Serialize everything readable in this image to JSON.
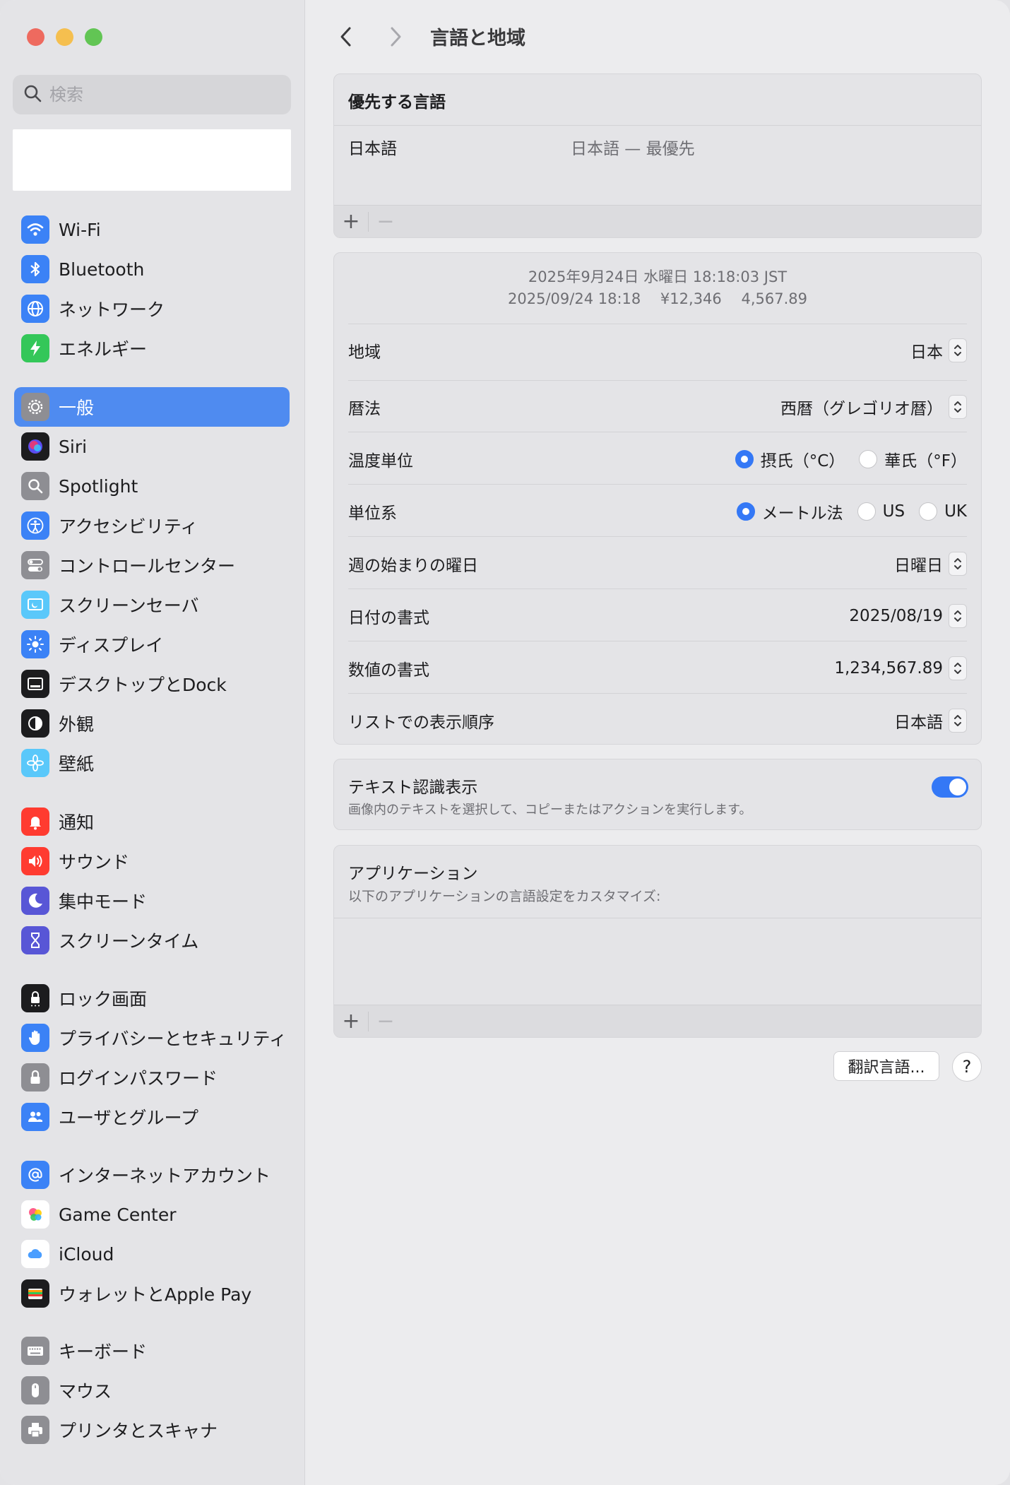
{
  "search": {
    "placeholder": "検索"
  },
  "sidebar": {
    "items": [
      {
        "label": "Wi-Fi",
        "icon": "wifi-icon",
        "color": "#3b82f6"
      },
      {
        "label": "Bluetooth",
        "icon": "bluetooth-icon",
        "color": "#3b82f6"
      },
      {
        "label": "ネットワーク",
        "icon": "globe-icon",
        "color": "#3b82f6"
      },
      {
        "label": "エネルギー",
        "icon": "bolt-icon",
        "color": "#34c759"
      },
      {
        "label": "一般",
        "icon": "gear-icon",
        "color": "#8e8e93",
        "selected": true
      },
      {
        "label": "Siri",
        "icon": "siri-icon",
        "color": "#1c1c1e"
      },
      {
        "label": "Spotlight",
        "icon": "magnifier-icon",
        "color": "#8e8e93"
      },
      {
        "label": "アクセシビリティ",
        "icon": "accessibility-icon",
        "color": "#3b82f6"
      },
      {
        "label": "コントロールセンター",
        "icon": "toggles-icon",
        "color": "#8e8e93"
      },
      {
        "label": "スクリーンセーバ",
        "icon": "screensaver-icon",
        "color": "#5ac8fa"
      },
      {
        "label": "ディスプレイ",
        "icon": "sun-icon",
        "color": "#3b82f6"
      },
      {
        "label": "デスクトップとDock",
        "icon": "dock-icon",
        "color": "#1c1c1e"
      },
      {
        "label": "外観",
        "icon": "appearance-icon",
        "color": "#1c1c1e"
      },
      {
        "label": "壁紙",
        "icon": "flower-icon",
        "color": "#5ac8fa"
      },
      {
        "label": "通知",
        "icon": "bell-icon",
        "color": "#ff3b30"
      },
      {
        "label": "サウンド",
        "icon": "speaker-icon",
        "color": "#ff3b30"
      },
      {
        "label": "集中モード",
        "icon": "moon-icon",
        "color": "#5856d6"
      },
      {
        "label": "スクリーンタイム",
        "icon": "hourglass-icon",
        "color": "#5856d6"
      },
      {
        "label": "ロック画面",
        "icon": "lock-screen-icon",
        "color": "#1c1c1e"
      },
      {
        "label": "プライバシーとセキュリティ",
        "icon": "hand-icon",
        "color": "#3b82f6"
      },
      {
        "label": "ログインパスワード",
        "icon": "lock-icon",
        "color": "#8e8e93"
      },
      {
        "label": "ユーザとグループ",
        "icon": "users-icon",
        "color": "#3b82f6"
      },
      {
        "label": "インターネットアカウント",
        "icon": "at-icon",
        "color": "#3b82f6"
      },
      {
        "label": "Game Center",
        "icon": "game-center-icon",
        "color": "#ffffff"
      },
      {
        "label": "iCloud",
        "icon": "cloud-icon",
        "color": "#ffffff"
      },
      {
        "label": "ウォレットとApple Pay",
        "icon": "wallet-icon",
        "color": "#1c1c1e"
      },
      {
        "label": "キーボード",
        "icon": "keyboard-icon",
        "color": "#8e8e93"
      },
      {
        "label": "マウス",
        "icon": "mouse-icon",
        "color": "#8e8e93"
      },
      {
        "label": "プリンタとスキャナ",
        "icon": "printer-icon",
        "color": "#8e8e93"
      }
    ]
  },
  "toolbar": {
    "title": "言語と地域"
  },
  "preferred": {
    "title": "優先する言語",
    "language": "日本語",
    "language_detail": "日本語 — 最優先",
    "add": "+",
    "remove": "−"
  },
  "region": {
    "preview_line1": "2025年9月24日 水曜日 18:18:03 JST",
    "preview_line2": "2025/09/24 18:18　 ¥12,346　 4,567.89",
    "rows": {
      "region": {
        "label": "地域",
        "value": "日本"
      },
      "calendar": {
        "label": "暦法",
        "value": "西暦（グレゴリオ暦）"
      },
      "temperature": {
        "label": "温度単位",
        "options": [
          "摂氏（°C）",
          "華氏（°F）"
        ],
        "selected": 0
      },
      "measurement": {
        "label": "単位系",
        "options": [
          "メートル法",
          "US",
          "UK"
        ],
        "selected": 0
      },
      "first_day": {
        "label": "週の始まりの曜日",
        "value": "日曜日"
      },
      "date_format": {
        "label": "日付の書式",
        "value": "2025/08/19"
      },
      "number_format": {
        "label": "数値の書式",
        "value": "1,234,567.89"
      },
      "list_order": {
        "label": "リストでの表示順序",
        "value": "日本語"
      }
    }
  },
  "live_text": {
    "title": "テキスト認識表示",
    "description": "画像内のテキストを選択して、コピーまたはアクションを実行します。",
    "enabled": true
  },
  "applications": {
    "title": "アプリケーション",
    "description": "以下のアプリケーションの言語設定をカスタマイズ:",
    "add": "+",
    "remove": "−"
  },
  "buttons": {
    "translate": "翻訳言語...",
    "help": "?"
  },
  "colors": {
    "accent": "#3478f6",
    "selected_sidebar": "#4f8bf0"
  }
}
